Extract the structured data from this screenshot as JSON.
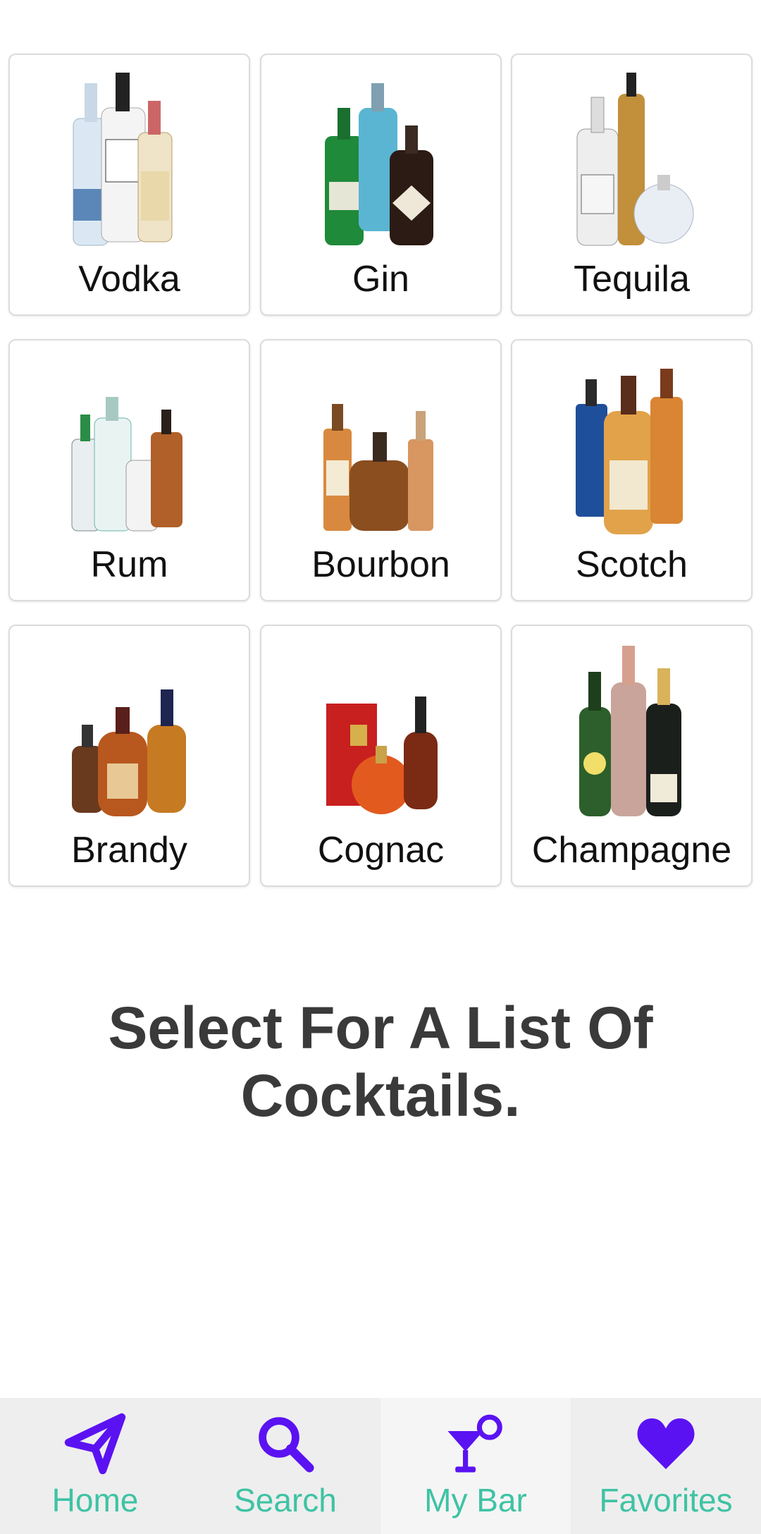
{
  "categories": [
    {
      "label": "Vodka"
    },
    {
      "label": "Gin"
    },
    {
      "label": "Tequila"
    },
    {
      "label": "Rum"
    },
    {
      "label": "Bourbon"
    },
    {
      "label": "Scotch"
    },
    {
      "label": "Brandy"
    },
    {
      "label": "Cognac"
    },
    {
      "label": "Champagne"
    }
  ],
  "prompt": {
    "text": "Select For A List Of Cocktails."
  },
  "tabbar": {
    "items": [
      {
        "label": "Home",
        "icon": "paper-plane-icon"
      },
      {
        "label": "Search",
        "icon": "search-icon"
      },
      {
        "label": "My Bar",
        "icon": "cocktail-glass-icon"
      },
      {
        "label": "Favorites",
        "icon": "heart-icon"
      }
    ],
    "icon_color": "#5b12f2",
    "label_color": "#3ec3a4"
  }
}
